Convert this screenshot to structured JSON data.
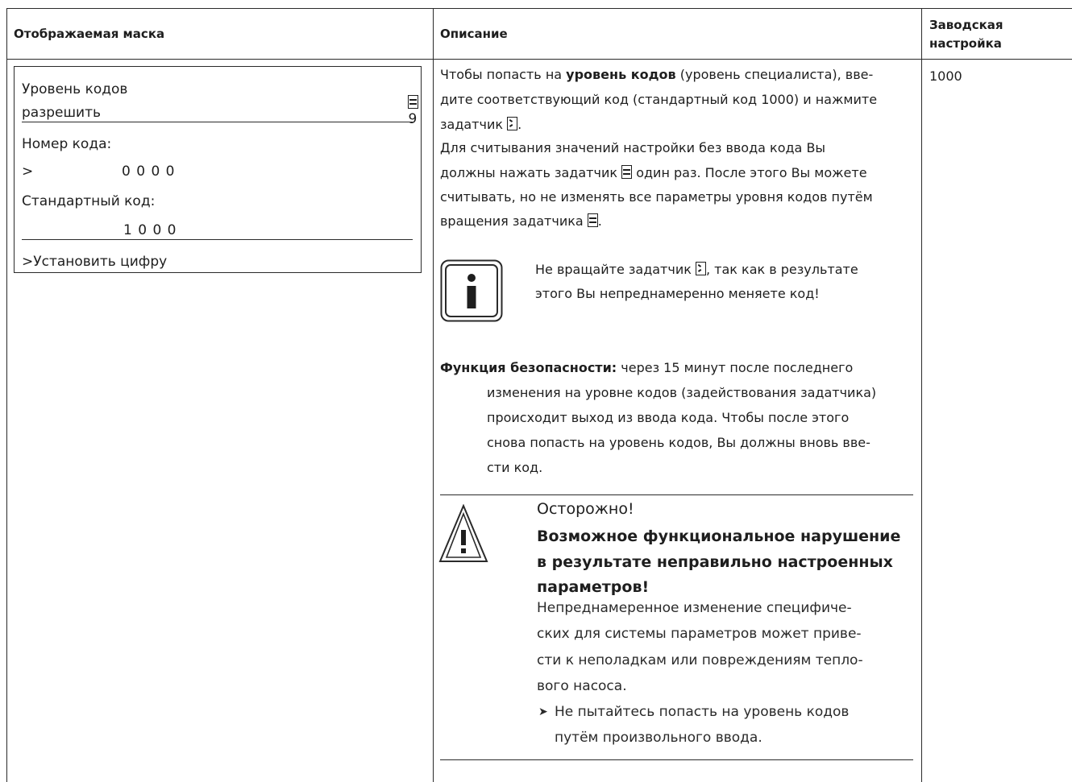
{
  "table_header": {
    "col1": "Отображаемая маска",
    "col2": "Описание",
    "col3_line1": "Заводская",
    "col3_line2": "настройка"
  },
  "mask": {
    "title_line1": "Уровень кодов",
    "title_line2": "разрешить",
    "page_number": "9",
    "code_label": "Номер кода:",
    "code_prompt": ">",
    "code_value": "0 0 0 0",
    "std_label": "Стандартный код:",
    "std_value": "1 0 0 0",
    "footer": ">Установить цифру"
  },
  "factory_setting": "1000",
  "description": {
    "p1_part1": "Чтобы попасть на ",
    "p1_bold": "уровень кодов",
    "p1_part2": " (уровень специалиста), вве-",
    "p1_line2": "дите соответствующий код (стандартный код 1000) и нажмите",
    "p1_line3": "задатчик",
    "p2_line1": "Для считывания значений настройки без ввода кода Вы",
    "p2_line2a": "должны нажать задатчик",
    "p2_line2b": " один раз. После этого Вы можете",
    "p2_line3": "считывать, но не изменять все параметры уровня кодов путём",
    "p2_line4": "вращения задатчика"
  },
  "info_note": {
    "line1a": "Не вращайте задатчик",
    "line1b": ", так как в результате",
    "line2": "этого Вы непреднамеренно меняете код!"
  },
  "safety": {
    "label": "Функция безопасности:",
    "line1": " через 15 минут после последнего",
    "line2": "изменения на уровне кодов (задействования задатчика)",
    "line3": "происходит выход из ввода кода. Чтобы после этого",
    "line4": "снова попасть на уровень кодов, Вы должны вновь вве-",
    "line5": "сти код."
  },
  "warning": {
    "title1": "Осторожно!",
    "title2": "Возможное функциональное нарушение",
    "title3": "в результате неправильно настроенных",
    "title4": "параметров!",
    "body1": "Непреднамеренное изменение специфиче-",
    "body2": "ских для системы параметров может приве-",
    "body3": "сти к неполадкам или повреждениям тепло-",
    "body4": "вого насоса.",
    "bullet_glyph": "➤",
    "action1": "Не пытайтесь попасть на уровень кодов",
    "action2": "путём произвольного ввода."
  }
}
